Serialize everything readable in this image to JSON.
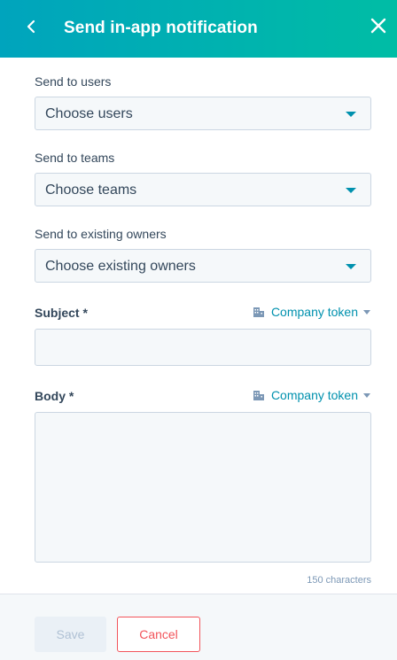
{
  "header": {
    "title": "Send in-app notification",
    "back_icon": "chevron-left-icon",
    "close_icon": "close-icon",
    "colors": {
      "start": "#00a4bd",
      "end": "#00bda5"
    }
  },
  "fields": {
    "users": {
      "label": "Send to users",
      "value": "Choose users"
    },
    "teams": {
      "label": "Send to teams",
      "value": "Choose teams"
    },
    "owners": {
      "label": "Send to existing owners",
      "value": "Choose existing owners"
    },
    "subject": {
      "label": "Subject *",
      "token_label": "Company token",
      "value": ""
    },
    "body": {
      "label": "Body *",
      "token_label": "Company token",
      "value": "",
      "char_count": "150 characters"
    }
  },
  "footer": {
    "save_label": "Save",
    "cancel_label": "Cancel"
  },
  "colors": {
    "accent": "#0091ae",
    "cancel": "#f2545b"
  }
}
